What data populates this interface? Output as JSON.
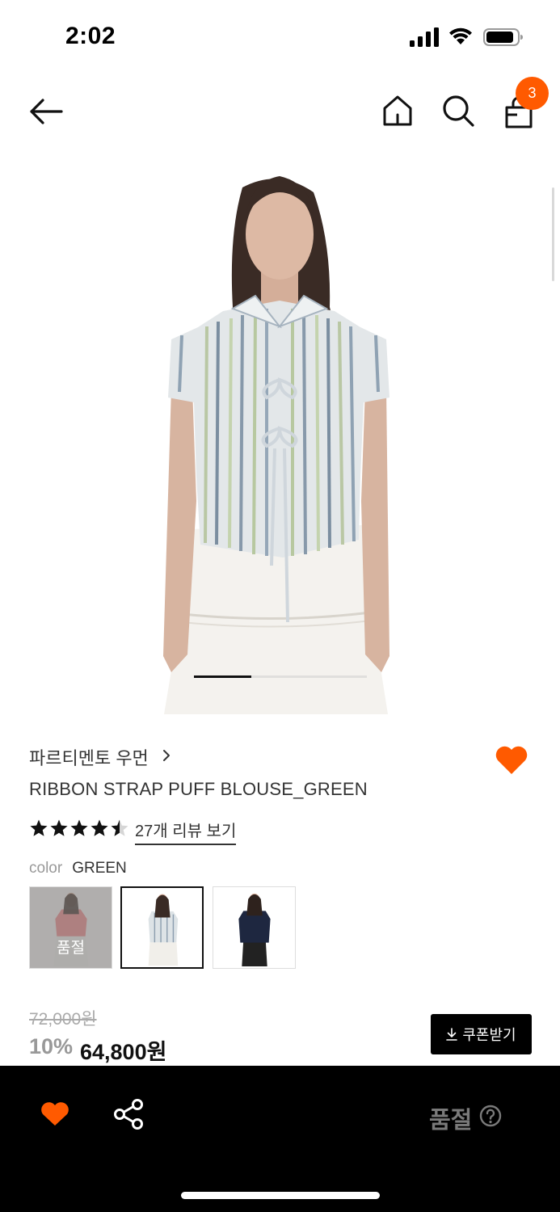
{
  "status_bar": {
    "time": "2:02"
  },
  "nav": {
    "cart_count": "3"
  },
  "carousel": {
    "slide_count": 3,
    "active_index": 0
  },
  "product": {
    "brand": "파르티멘토 우먼",
    "name": "RIBBON STRAP PUFF BLOUSE_GREEN",
    "rating": 4.5,
    "review_link": "27개 리뷰 보기",
    "color_label": "color",
    "color_value": "GREEN",
    "swatches": [
      {
        "color": "pink",
        "soldout_text": "품절"
      },
      {
        "color": "green",
        "selected": true
      },
      {
        "color": "navy"
      }
    ],
    "original_price": "72,000원",
    "discount": "10%",
    "sale_price": "64,800원",
    "coupon_button": "쿠폰받기"
  },
  "bottom_bar": {
    "soldout_label": "품절"
  },
  "colors": {
    "accent": "#ff5a00",
    "black": "#000000"
  },
  "icons": [
    "back-arrow-icon",
    "home-icon",
    "search-icon",
    "shopping-bag-icon",
    "chevron-right-icon",
    "heart-icon",
    "star-icon",
    "download-icon",
    "share-icon",
    "question-icon"
  ]
}
